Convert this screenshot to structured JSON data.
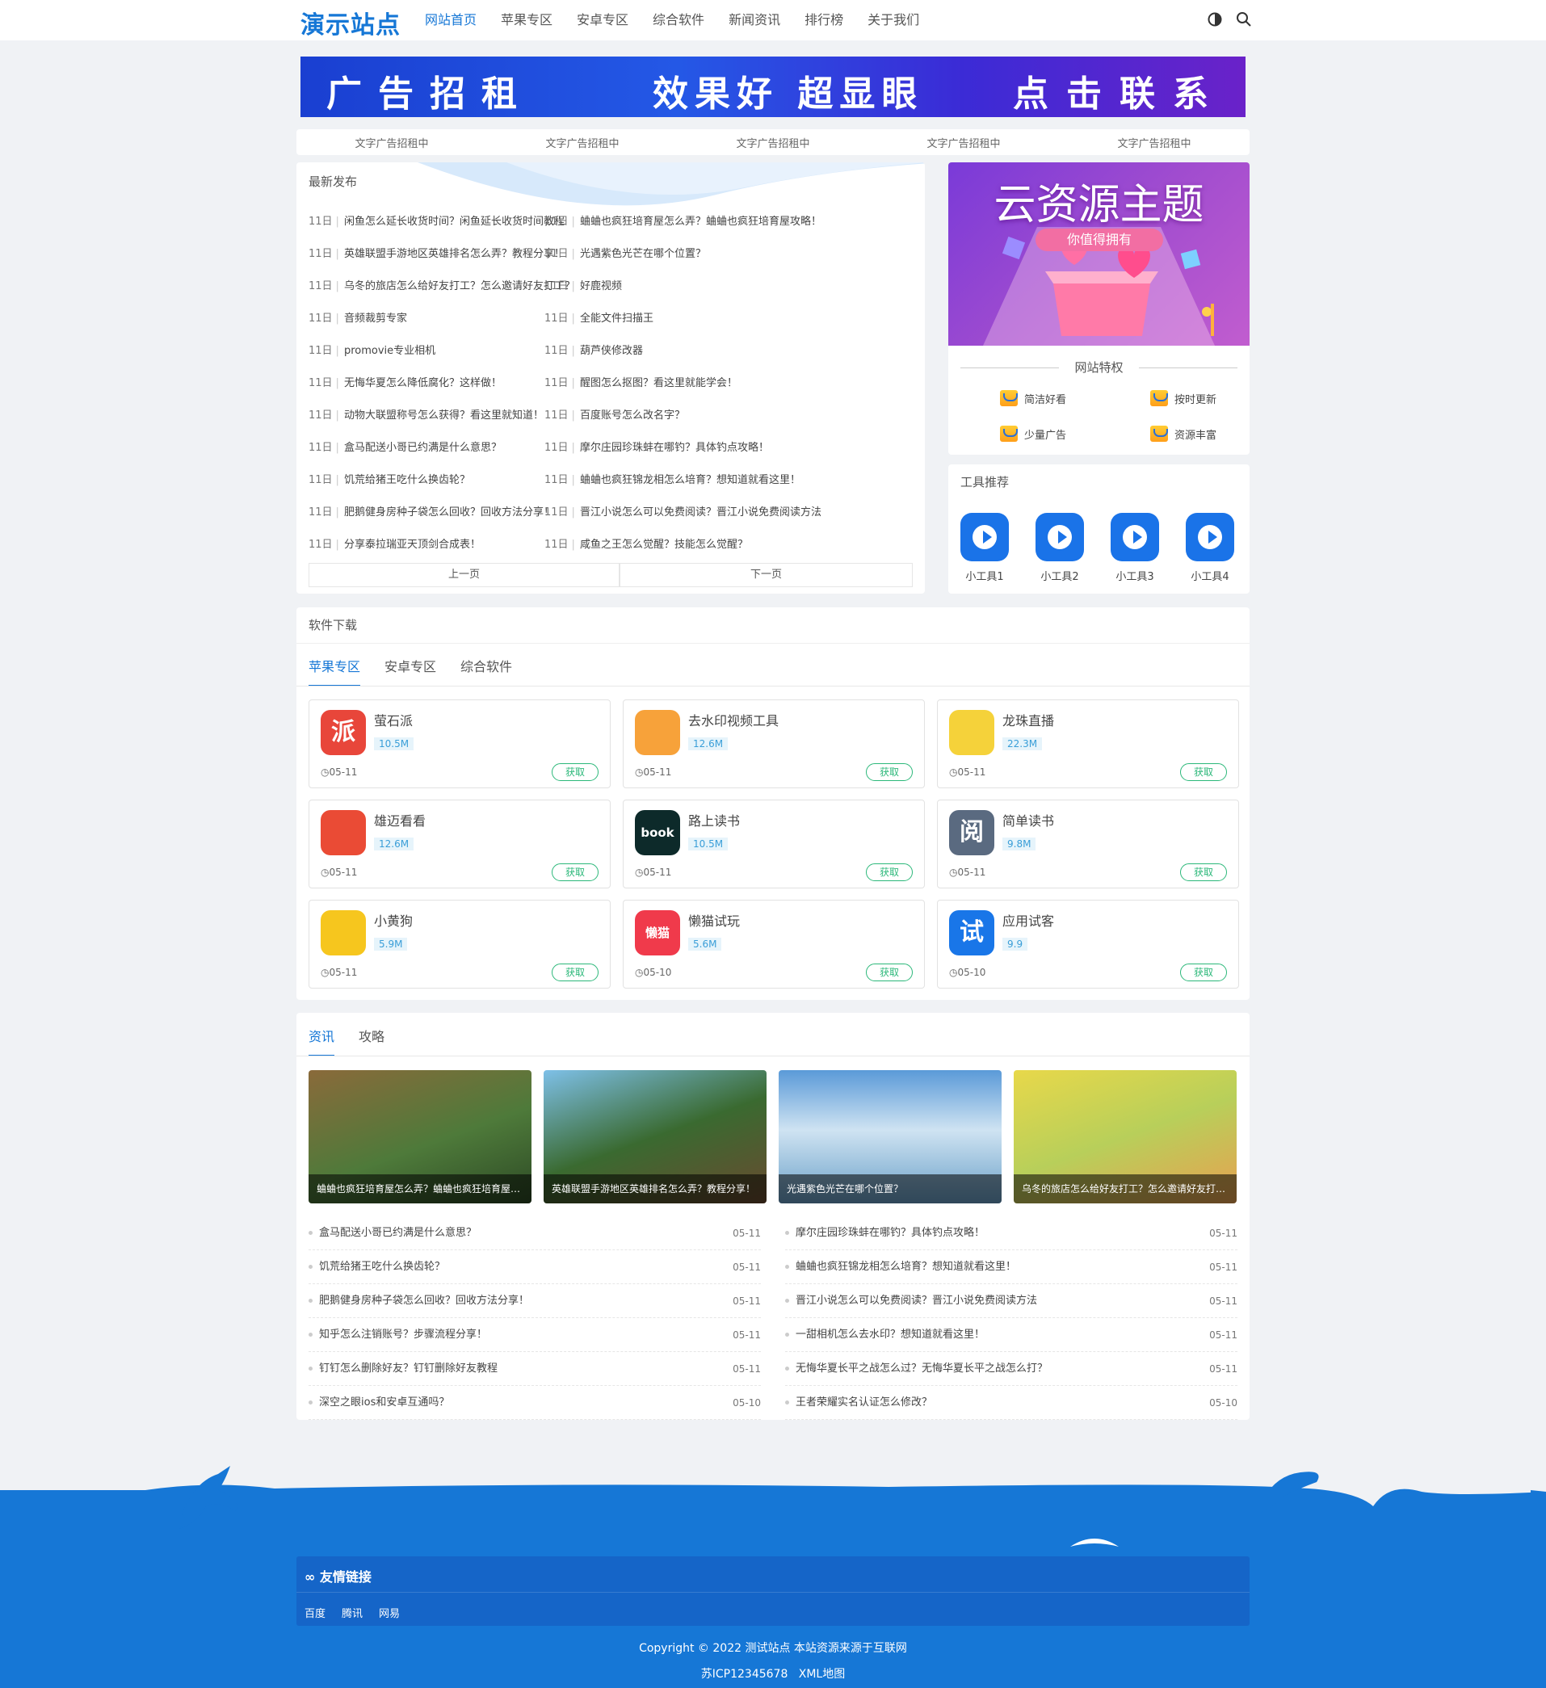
{
  "header": {
    "logo": "演示站点",
    "nav": [
      "网站首页",
      "苹果专区",
      "安卓专区",
      "综合软件",
      "新闻资讯",
      "排行榜",
      "关于我们"
    ],
    "active_index": 0,
    "accent": "#1677d6"
  },
  "banner": {
    "part1": "广告招租",
    "part2": "效果好 超显眼",
    "part3": "点击联系"
  },
  "text_ads": [
    "文字广告招租中",
    "文字广告招租中",
    "文字广告招租中",
    "文字广告招租中",
    "文字广告招租中"
  ],
  "latest": {
    "title": "最新发布",
    "left": [
      {
        "day": "11日",
        "text": "闲鱼怎么延长收货时间？闲鱼延长收货时间教程"
      },
      {
        "day": "11日",
        "text": "英雄联盟手游地区英雄排名怎么弄？教程分享！"
      },
      {
        "day": "11日",
        "text": "乌冬的旅店怎么给好友打工？怎么邀请好友打工？"
      },
      {
        "day": "11日",
        "text": "音频裁剪专家"
      },
      {
        "day": "11日",
        "text": "promovie专业相机"
      },
      {
        "day": "11日",
        "text": "无悔华夏怎么降低腐化？这样做！"
      },
      {
        "day": "11日",
        "text": "动物大联盟称号怎么获得？看这里就知道！"
      },
      {
        "day": "11日",
        "text": "盒马配送小哥已约满是什么意思？"
      },
      {
        "day": "11日",
        "text": "饥荒给猪王吃什么换齿轮？"
      },
      {
        "day": "11日",
        "text": "肥鹅健身房种子袋怎么回收？回收方法分享！"
      },
      {
        "day": "11日",
        "text": "分享泰拉瑞亚天顶剑合成表！"
      }
    ],
    "right": [
      {
        "day": "11日",
        "text": "蛐蛐也疯狂培育屋怎么弄？蛐蛐也疯狂培育屋攻略！"
      },
      {
        "day": "11日",
        "text": "光遇紫色光芒在哪个位置？"
      },
      {
        "day": "11日",
        "text": "好鹿视频"
      },
      {
        "day": "11日",
        "text": "全能文件扫描王"
      },
      {
        "day": "11日",
        "text": "葫芦侠修改器"
      },
      {
        "day": "11日",
        "text": "醒图怎么抠图？看这里就能学会！"
      },
      {
        "day": "11日",
        "text": "百度账号怎么改名字？"
      },
      {
        "day": "11日",
        "text": "摩尔庄园珍珠蚌在哪钓？具体钓点攻略！"
      },
      {
        "day": "11日",
        "text": "蛐蛐也疯狂锦龙相怎么培育？想知道就看这里！"
      },
      {
        "day": "11日",
        "text": "晋江小说怎么可以免费阅读？晋江小说免费阅读方法"
      },
      {
        "day": "11日",
        "text": "咸鱼之王怎么觉醒？技能怎么觉醒？"
      }
    ],
    "prev": "上一页",
    "next": "下一页"
  },
  "promo": {
    "title": "云资源主题",
    "subtitle": "你值得拥有",
    "features_title": "网站特权",
    "features": [
      "简洁好看",
      "按时更新",
      "少量广告",
      "资源丰富"
    ]
  },
  "tools": {
    "title": "工具推荐",
    "items": [
      "小工具1",
      "小工具2",
      "小工具3",
      "小工具4"
    ]
  },
  "software": {
    "title": "软件下载",
    "tabs": [
      "苹果专区",
      "安卓专区",
      "综合软件"
    ],
    "get_label": "获取",
    "apps": [
      {
        "name": "萤石派",
        "size": "10.5M",
        "date": "05-11",
        "icon": "派",
        "color": "#e8463a"
      },
      {
        "name": "去水印视频工具",
        "size": "12.6M",
        "date": "05-11",
        "icon": "footprint-icon",
        "color": "#f7a23a"
      },
      {
        "name": "龙珠直播",
        "size": "22.3M",
        "date": "05-11",
        "icon": "dragon-icon",
        "color": "#f5d23a"
      },
      {
        "name": "雄迈看看",
        "size": "12.6M",
        "date": "05-11",
        "icon": "camera-icon",
        "color": "#ea4b35"
      },
      {
        "name": "路上读书",
        "size": "10.5M",
        "date": "05-11",
        "icon": "book",
        "color": "#0d2a2a"
      },
      {
        "name": "简单读书",
        "size": "9.8M",
        "date": "05-11",
        "icon": "阅",
        "color": "#5a6a80"
      },
      {
        "name": "小黄狗",
        "size": "5.9M",
        "date": "05-11",
        "icon": "dog-icon",
        "color": "#f6c61e"
      },
      {
        "name": "懒猫试玩",
        "size": "5.6M",
        "date": "05-10",
        "icon": "懒猫",
        "color": "#f03a4b"
      },
      {
        "name": "应用试客",
        "size": "9.9",
        "date": "05-10",
        "icon": "试",
        "color": "#1976e8"
      }
    ]
  },
  "news": {
    "tabs": [
      "资讯",
      "攻略"
    ],
    "pictures": [
      {
        "caption": "蛐蛐也疯狂培育屋怎么弄？蛐蛐也疯狂培育屋攻略！"
      },
      {
        "caption": "英雄联盟手游地区英雄排名怎么弄？教程分享！"
      },
      {
        "caption": "光遇紫色光芒在哪个位置？"
      },
      {
        "caption": "乌冬的旅店怎么给好友打工？怎么邀请好友打工？"
      }
    ],
    "left": [
      {
        "text": "盒马配送小哥已约满是什么意思？",
        "date": "05-11"
      },
      {
        "text": "饥荒给猪王吃什么换齿轮？",
        "date": "05-11"
      },
      {
        "text": "肥鹅健身房种子袋怎么回收？回收方法分享！",
        "date": "05-11"
      },
      {
        "text": "知乎怎么注销账号？步骤流程分享！",
        "date": "05-11"
      },
      {
        "text": "钉钉怎么删除好友？钉钉删除好友教程",
        "date": "05-11"
      },
      {
        "text": "深空之眼ios和安卓互通吗？",
        "date": "05-10"
      }
    ],
    "right": [
      {
        "text": "摩尔庄园珍珠蚌在哪钓？具体钓点攻略！",
        "date": "05-11"
      },
      {
        "text": "蛐蛐也疯狂锦龙相怎么培育？想知道就看这里！",
        "date": "05-11"
      },
      {
        "text": "晋江小说怎么可以免费阅读？晋江小说免费阅读方法",
        "date": "05-11"
      },
      {
        "text": "一甜相机怎么去水印？想知道就看这里！",
        "date": "05-11"
      },
      {
        "text": "无悔华夏长平之战怎么过？无悔华夏长平之战怎么打？",
        "date": "05-11"
      },
      {
        "text": "王者荣耀实名认证怎么修改？",
        "date": "05-10"
      }
    ]
  },
  "footer": {
    "links_title": "友情链接",
    "links": [
      "百度",
      "腾讯",
      "网易"
    ],
    "copyright": "Copyright © 2022 测试站点 本站资源来源于互联网",
    "icp": "苏ICP12345678",
    "sitemap": "XML地图",
    "bg_color": "#1677d6"
  }
}
